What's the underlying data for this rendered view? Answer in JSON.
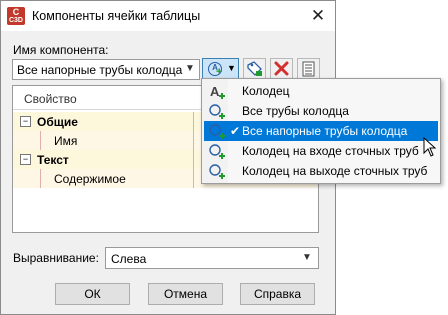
{
  "window": {
    "title": "Компоненты ячейки таблицы",
    "close": "✕",
    "app_icon_text_top": "C",
    "app_icon_text_bottom": "C3D"
  },
  "component": {
    "label": "Имя компонента:",
    "selected": "Все напорные трубы колодца"
  },
  "grid": {
    "header": "Свойство",
    "rows": [
      {
        "type": "category",
        "label": "Общие",
        "expander": "−"
      },
      {
        "type": "item",
        "label": "Имя"
      },
      {
        "type": "category",
        "label": "Текст",
        "expander": "−"
      },
      {
        "type": "item",
        "label": "Содержимое"
      }
    ]
  },
  "alignment": {
    "label": "Выравнивание:",
    "value": "Слева"
  },
  "buttons": {
    "ok": "ОК",
    "cancel": "Отмена",
    "help": "Справка"
  },
  "menu": {
    "items": [
      {
        "label": "Колодец",
        "icon": "text-add-icon"
      },
      {
        "label": "Все трубы колодца",
        "icon": "component-add-icon"
      },
      {
        "label": "Все напорные трубы колодца",
        "icon": "component-add-icon",
        "selected": true
      },
      {
        "label": "Колодец на входе сточных труб",
        "icon": "component-add-icon"
      },
      {
        "label": "Колодец на выходе сточных труб",
        "icon": "component-add-icon"
      }
    ]
  },
  "colors": {
    "selection": "#0078d7",
    "category_row": "#fdf7dc",
    "delete_red": "#d32f2f"
  }
}
